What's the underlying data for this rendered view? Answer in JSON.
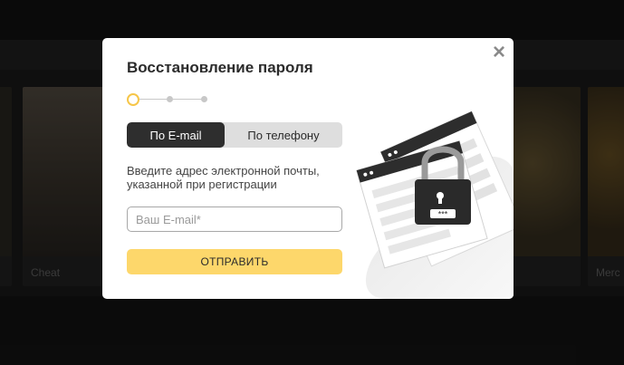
{
  "background": {
    "cards": [
      {
        "caption": "",
        "tone": "#2d2a24"
      },
      {
        "caption": "Cheat",
        "tone": "#4a4339"
      },
      {
        "caption": "",
        "tone": "#3b3731"
      },
      {
        "caption": "",
        "tone": "#403823"
      },
      {
        "caption": "",
        "tone": "#4a3a1c"
      },
      {
        "caption": "Merc",
        "tone": "#3e3321"
      }
    ]
  },
  "modal": {
    "close_symbol": "×",
    "title": "Восстановление пароля",
    "steps": {
      "total": 3,
      "current": 1
    },
    "tabs": {
      "email": "По E-mail",
      "phone": "По телефону",
      "active": "email"
    },
    "hint": "Введите адрес электронной почты, указанной при регистрации",
    "email_placeholder": "Ваш E-mail*",
    "email_value": "",
    "submit_label": "ОТПРАВИТЬ",
    "illustration_icon": "locked-document-icon"
  },
  "colors": {
    "accent": "#fdd76b",
    "step_active": "#f6c649",
    "tab_active": "#2e2e2e"
  }
}
